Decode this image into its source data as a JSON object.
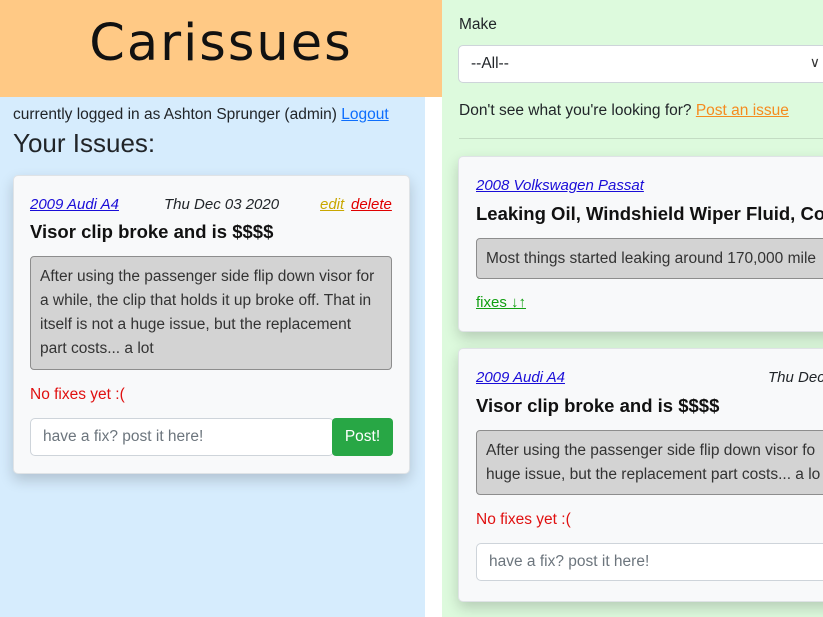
{
  "app": {
    "logo": "Carissues"
  },
  "account": {
    "prefix": "currently logged in as Ashton Sprunger (admin)",
    "logout": "Logout"
  },
  "your_issues": {
    "heading": "Your Issues:",
    "issue": {
      "vehicle": "2009 Audi A4",
      "date": "Thu Dec 03 2020",
      "edit": "edit",
      "delete": "delete",
      "title": "Visor clip broke and is $$$$",
      "description": "After using the passenger side flip down visor for a while, the clip that holds it up broke off. That in itself is not a huge issue, but the replacement part costs... a lot",
      "status": "No fixes yet :(",
      "fix_placeholder": "have a fix? post it here!",
      "post_label": "Post!"
    }
  },
  "feed": {
    "make_label": "Make",
    "make_selected": "--All--",
    "prompt": "Don't see what you're looking for?",
    "post_link": "Post an issue",
    "issues": [
      {
        "vehicle": "2008 Volkswagen Passat",
        "title": "Leaking Oil, Windshield Wiper Fluid, Co",
        "description": "Most things started leaking around 170,000 mile",
        "fixes_label": "fixes ↓↑"
      },
      {
        "vehicle": "2009 Audi A4",
        "date": "Thu Dec",
        "title": "Visor clip broke and is $$$$",
        "description": "After using the passenger side flip down visor fo huge issue, but the replacement part costs... a lo",
        "status": "No fixes yet :(",
        "fix_placeholder": "have a fix? post it here!"
      }
    ]
  },
  "colors": {
    "left_bg": "#d6ecfd",
    "right_bg": "#ddfadd",
    "banner_bg": "#ffc985",
    "post_button": "#28a745"
  }
}
